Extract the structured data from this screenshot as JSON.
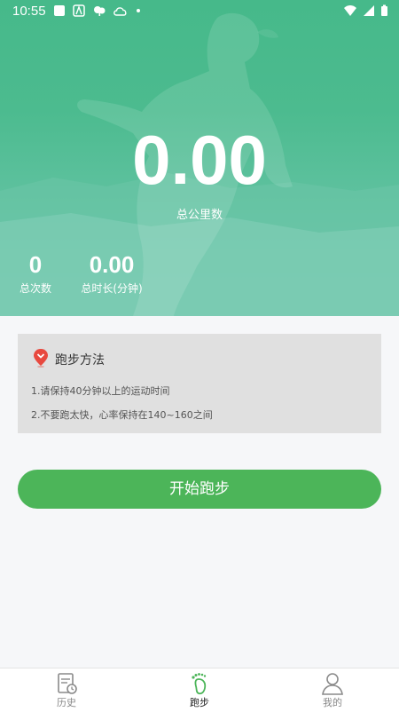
{
  "status_bar": {
    "time": "10:55"
  },
  "summary": {
    "total_km": "0.00",
    "total_km_label": "总公里数",
    "total_count": "0",
    "total_count_label": "总次数",
    "total_minutes": "0.00",
    "total_minutes_label": "总时长(分钟)"
  },
  "method_card": {
    "title": "跑步方法",
    "icon": "location-pin-icon",
    "lines": [
      "1.请保持40分钟以上的运动时间",
      "2.不要跑太快，心率保持在140~160之间"
    ]
  },
  "start_button": {
    "label": "开始跑步"
  },
  "tabbar": {
    "tabs": [
      {
        "label": "历史",
        "icon": "history-icon"
      },
      {
        "label": "跑步",
        "icon": "footprint-icon",
        "active": true
      },
      {
        "label": "我的",
        "icon": "person-icon"
      }
    ]
  },
  "colors": {
    "hero": "#4cbb8f",
    "accent": "#4cb559",
    "card": "#e0e0e0",
    "pin": "#e8493f"
  }
}
